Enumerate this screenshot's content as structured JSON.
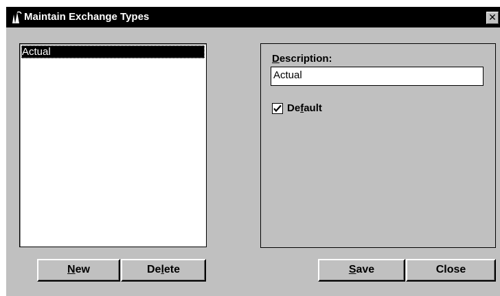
{
  "window": {
    "title": "Maintain Exchange Types",
    "close_glyph": "✕",
    "icon": "app-icon"
  },
  "list": {
    "items": [
      {
        "label": "Actual",
        "selected": true
      }
    ]
  },
  "form": {
    "description_label_mnemonic": "D",
    "description_label_rest": "escription:",
    "description_value": "Actual",
    "default_label_pre": "De",
    "default_label_mnemonic": "f",
    "default_label_post": "ault",
    "default_checked": true
  },
  "buttons": {
    "new_mnemonic": "N",
    "new_rest": "ew",
    "delete_pre": "De",
    "delete_mnemonic": "l",
    "delete_post": "ete",
    "save_mnemonic": "S",
    "save_rest": "ave",
    "close_label": "Close"
  },
  "colors": {
    "window_bg": "#c0c0c0",
    "titlebar_bg": "#000000",
    "selection_bg": "#000000"
  }
}
